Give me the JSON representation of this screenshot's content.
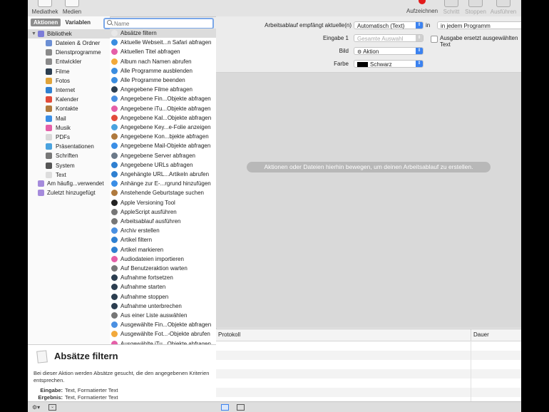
{
  "toolbar": {
    "left": [
      {
        "label": "Mediathek",
        "icon": "library-icon"
      },
      {
        "label": "Medien",
        "icon": "media-icon"
      }
    ],
    "right": [
      {
        "label": "Aufzeichnen",
        "icon": "record-icon",
        "enabled": true
      },
      {
        "label": "Schritt",
        "icon": "step-icon",
        "enabled": false
      },
      {
        "label": "Stoppen",
        "icon": "stop-icon",
        "enabled": false
      },
      {
        "label": "Ausführen",
        "icon": "run-icon",
        "enabled": false
      }
    ]
  },
  "library": {
    "tabs": [
      "Aktionen",
      "Variablen"
    ],
    "active_tab": "Aktionen",
    "root": "Bibliothek",
    "items": [
      {
        "label": "Dateien & Ordner",
        "color": "#6b8fd4"
      },
      {
        "label": "Dienstprogramme",
        "color": "#8a8a8a"
      },
      {
        "label": "Entwickler",
        "color": "#8a8a8a"
      },
      {
        "label": "Filme",
        "color": "#2c3e50"
      },
      {
        "label": "Fotos",
        "color": "#e0a33a"
      },
      {
        "label": "Internet",
        "color": "#2f80d1"
      },
      {
        "label": "Kalender",
        "color": "#e24b3b"
      },
      {
        "label": "Kontakte",
        "color": "#b07a3e"
      },
      {
        "label": "Mail",
        "color": "#3a8ee6"
      },
      {
        "label": "Musik",
        "color": "#e55fa8"
      },
      {
        "label": "PDFs",
        "color": "#d9d9d9"
      },
      {
        "label": "Präsentationen",
        "color": "#4aa3df"
      },
      {
        "label": "Schriften",
        "color": "#777777"
      },
      {
        "label": "System",
        "color": "#555555"
      },
      {
        "label": "Text",
        "color": "#dddddd"
      }
    ],
    "smart": [
      {
        "label": "Am häufig...verwendet",
        "color": "#a58bdc"
      },
      {
        "label": "Zuletzt hinzugefügt",
        "color": "#a58bdc"
      }
    ]
  },
  "search": {
    "placeholder": "Name",
    "value": ""
  },
  "actions": [
    {
      "label": "Absätze filtern",
      "color": "#e8e8e8",
      "selected": true
    },
    {
      "label": "Aktuelle Webseit...n Safari abfragen",
      "color": "#3b8de0"
    },
    {
      "label": "Aktuellen Titel abfragen",
      "color": "#e55fa8"
    },
    {
      "label": "Album nach Namen abrufen",
      "color": "#f2a93b"
    },
    {
      "label": "Alle Programme ausblenden",
      "color": "#3b8de0"
    },
    {
      "label": "Alle Programme beenden",
      "color": "#3b8de0"
    },
    {
      "label": "Angegebene Filme abfragen",
      "color": "#2c3e50"
    },
    {
      "label": "Angegebene Fin...Objekte abfragen",
      "color": "#4a90e2"
    },
    {
      "label": "Angegebene iTu...Objekte abfragen",
      "color": "#e55fa8"
    },
    {
      "label": "Angegebene Kal...Objekte abfragen",
      "color": "#e24b3b"
    },
    {
      "label": "Angegebene Key...e-Folie anzeigen",
      "color": "#4aa3df"
    },
    {
      "label": "Angegebene Kon...bjekte abfragen",
      "color": "#b07a3e"
    },
    {
      "label": "Angegebene Mail-Objekte abfragen",
      "color": "#3a8ee6"
    },
    {
      "label": "Angegebene Server abfragen",
      "color": "#6c7a89"
    },
    {
      "label": "Angegebene URLs abfragen",
      "color": "#2f80d1"
    },
    {
      "label": "Angehängte URL...Artikeln abrufen",
      "color": "#2f80d1"
    },
    {
      "label": "Anhänge zur E-...rgrund hinzufügen",
      "color": "#3a8ee6"
    },
    {
      "label": "Anstehende Geburtstage suchen",
      "color": "#b07a3e"
    },
    {
      "label": "Apple Versioning Tool",
      "color": "#222222"
    },
    {
      "label": "AppleScript ausführen",
      "color": "#777777"
    },
    {
      "label": "Arbeitsablauf ausführen",
      "color": "#777777"
    },
    {
      "label": "Archiv erstellen",
      "color": "#4a90e2"
    },
    {
      "label": "Artikel filtern",
      "color": "#2f80d1"
    },
    {
      "label": "Artikel markieren",
      "color": "#2f80d1"
    },
    {
      "label": "Audiodateien importieren",
      "color": "#e55fa8"
    },
    {
      "label": "Auf Benutzeraktion warten",
      "color": "#777777"
    },
    {
      "label": "Aufnahme fortsetzen",
      "color": "#2c3e50"
    },
    {
      "label": "Aufnahme starten",
      "color": "#2c3e50"
    },
    {
      "label": "Aufnahme stoppen",
      "color": "#2c3e50"
    },
    {
      "label": "Aufnahme unterbrechen",
      "color": "#2c3e50"
    },
    {
      "label": "Aus einer Liste auswählen",
      "color": "#777777"
    },
    {
      "label": "Ausgewählte Fin...Objekte abfragen",
      "color": "#4a90e2"
    },
    {
      "label": "Ausgewählte Fot...-Objekte abrufen",
      "color": "#f2a93b"
    },
    {
      "label": "Ausgewählte iTu...Objekte abfragen",
      "color": "#e55fa8"
    }
  ],
  "description": {
    "title": "Absätze filtern",
    "body": "Bei dieser Aktion werden Absätze gesucht, die den angegebenen Kriterien entsprechen.",
    "input_label": "Eingabe:",
    "input_value": "Text, Formatierter Text",
    "result_label": "Ergebnis:",
    "result_value": "Text, Formatierter Text"
  },
  "workflow": {
    "receives_label": "Arbeitsablauf empfängt aktuelle(n)",
    "receives_value": "Automatisch (Text)",
    "in_label": "in",
    "program_value": "in jedem Programm",
    "input_label": "Eingabe 1",
    "input_value": "Gesamte Auswahl",
    "replace_label": "Ausgabe ersetzt ausgewählten Text",
    "image_label": "Bild",
    "image_value": "Aktion",
    "color_label": "Farbe",
    "color_value": "Schwarz",
    "swatch": "#000000",
    "hint": "Aktionen oder Dateien hierhin bewegen, um deinen Arbeitsablauf zu erstellen."
  },
  "log": {
    "col_protocol": "Protokoll",
    "col_duration": "Dauer"
  }
}
